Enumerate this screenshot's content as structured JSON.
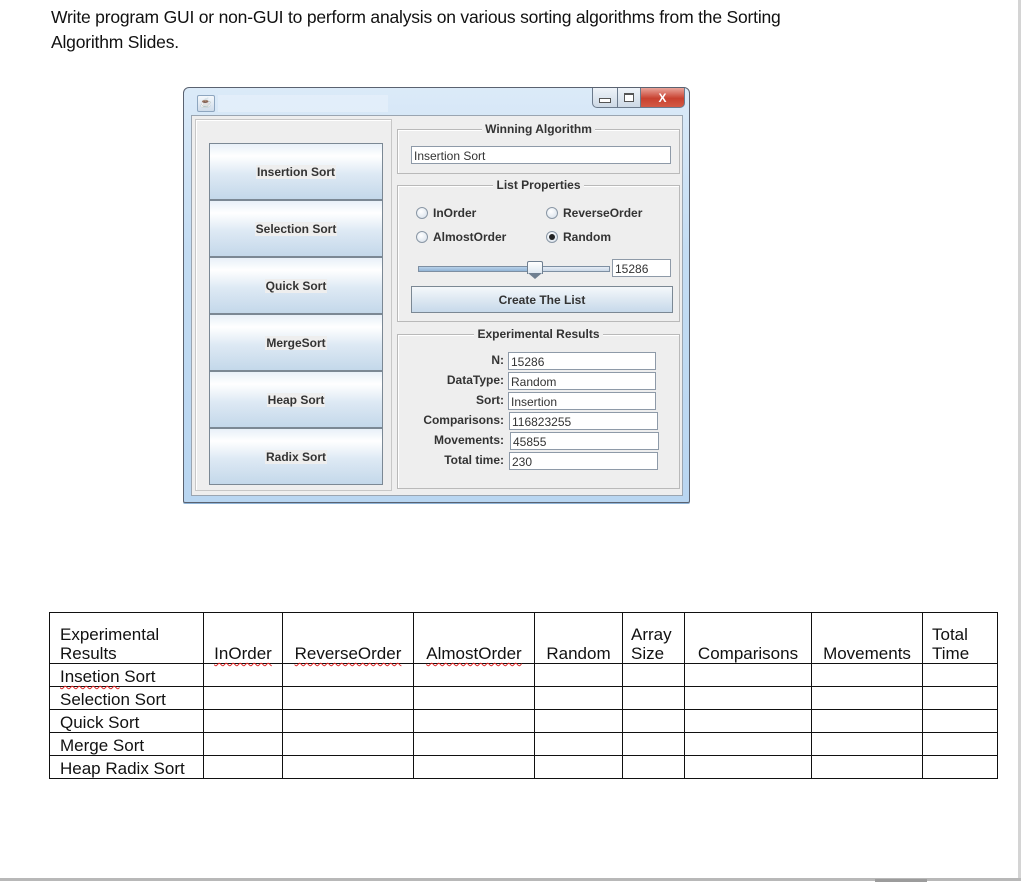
{
  "prompt": {
    "line1": "Write program GUI or non-GUI to perform analysis on various sorting algorithms from the Sorting",
    "line2": "Algorithm Slides."
  },
  "window": {
    "app_icon": "java-icon",
    "caption_buttons": [
      "minimize",
      "maximize",
      "close"
    ],
    "close_glyph": "X",
    "sort_buttons": [
      {
        "label": "Insertion Sort"
      },
      {
        "label": "Selection Sort"
      },
      {
        "label": "Quick Sort"
      },
      {
        "label": "MergeSort"
      },
      {
        "label": "Heap Sort"
      },
      {
        "label": "Radix Sort"
      }
    ],
    "winning": {
      "title": "Winning Algorithm",
      "value": "Insertion Sort"
    },
    "list_properties": {
      "title": "List Properties",
      "options": [
        {
          "label": "InOrder",
          "checked": false
        },
        {
          "label": "ReverseOrder",
          "checked": false
        },
        {
          "label": "AlmostOrder",
          "checked": false
        },
        {
          "label": "Random",
          "checked": true
        }
      ],
      "slider_fraction": 0.61,
      "size_value": "15286",
      "create_button": "Create The List"
    },
    "experimental_results": {
      "title": "Experimental Results",
      "fields": [
        {
          "label": "N:",
          "value": "15286"
        },
        {
          "label": "DataType:",
          "value": "Random"
        },
        {
          "label": "Sort:",
          "value": "Insertion"
        },
        {
          "label": "Comparisons:",
          "value": "116823255"
        },
        {
          "label": "Movements:",
          "value": "45855"
        },
        {
          "label": "Total time:",
          "value": "230"
        }
      ]
    }
  },
  "table": {
    "corner": [
      "Experimental",
      "Results"
    ],
    "columns": [
      {
        "lines": [
          "",
          "InOrder"
        ],
        "misspelled": true
      },
      {
        "lines": [
          "",
          "ReverseOrder"
        ],
        "misspelled": true
      },
      {
        "lines": [
          "",
          "AlmostOrder"
        ],
        "misspelled": true
      },
      {
        "lines": [
          "",
          "Random"
        ],
        "misspelled": false
      },
      {
        "lines": [
          "Array",
          "Size"
        ],
        "misspelled": false
      },
      {
        "lines": [
          "",
          "Comparisons"
        ],
        "misspelled": false
      },
      {
        "lines": [
          "",
          "Movements"
        ],
        "misspelled": false
      },
      {
        "lines": [
          "Total",
          "Time"
        ],
        "misspelled": false
      }
    ],
    "rows": [
      {
        "label": "Insetion Sort",
        "misspelled_word": "Insetion",
        "rest": " Sort",
        "cells": [
          "",
          "",
          "",
          "",
          "",
          "",
          "",
          ""
        ]
      },
      {
        "label": "Selection Sort",
        "cells": [
          "",
          "",
          "",
          "",
          "",
          "",
          "",
          ""
        ]
      },
      {
        "label": "Quick Sort",
        "cells": [
          "",
          "",
          "",
          "",
          "",
          "",
          "",
          ""
        ]
      },
      {
        "label": "Merge Sort",
        "cells": [
          "",
          "",
          "",
          "",
          "",
          "",
          "",
          ""
        ]
      },
      {
        "label": "Heap Radix Sort",
        "cells": [
          "",
          "",
          "",
          "",
          "",
          "",
          "",
          ""
        ]
      }
    ]
  }
}
